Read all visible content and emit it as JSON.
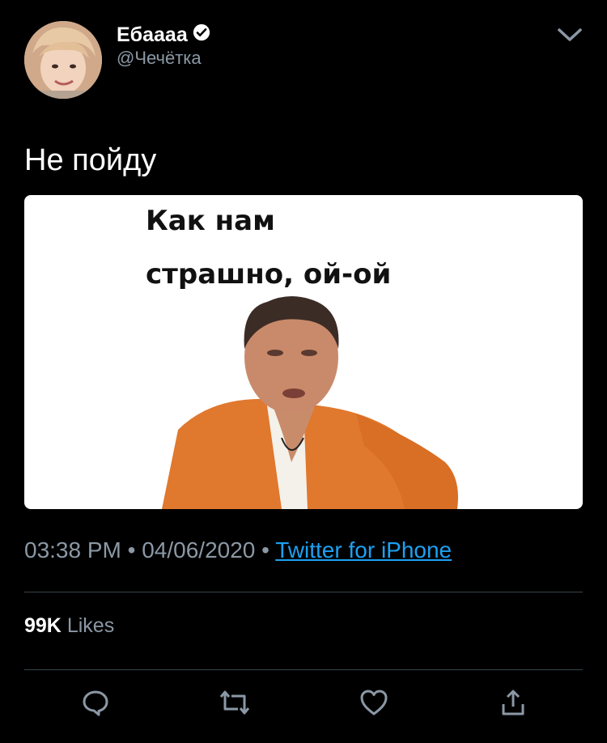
{
  "tweet": {
    "display_name": "Ебаааа",
    "handle": "@Чечётка",
    "text": "Не пойду",
    "time": "03:38 PM",
    "date": "04/06/2020",
    "separator": "•",
    "source": "Twitter for iPhone",
    "likes_count": "99K",
    "likes_label": "Likes"
  },
  "media": {
    "caption_line1": "Как нам",
    "caption_line2": "страшно, ой-ой"
  },
  "icons": {
    "verified": "verified-badge-icon",
    "more": "chevron-down-icon",
    "reply": "reply-icon",
    "retweet": "retweet-icon",
    "like": "heart-icon",
    "share": "share-icon"
  },
  "colors": {
    "background": "#000000",
    "secondary_text": "#8b98a5",
    "link": "#1da1f2",
    "divider": "#38444d"
  }
}
